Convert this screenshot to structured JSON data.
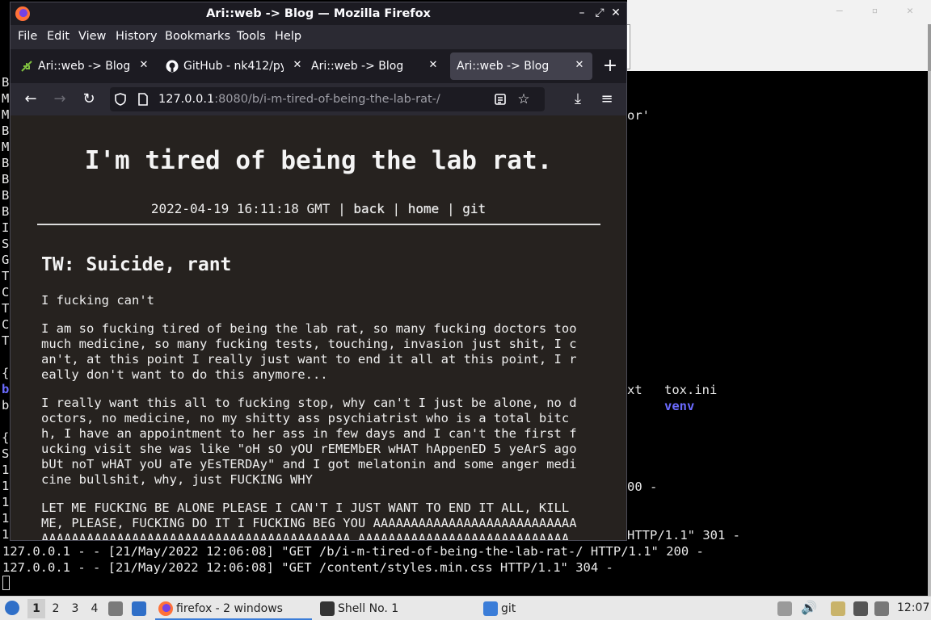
{
  "terminal": {
    "left_column": [
      "B",
      "M",
      "M",
      "B",
      "M",
      "B",
      "B",
      "B",
      "B",
      "I",
      "S",
      "G",
      "T",
      "C",
      "T",
      "C",
      "T",
      "",
      "{",
      "b",
      "b",
      "",
      "{",
      "S",
      "1",
      "1",
      "1",
      "1",
      "1"
    ],
    "fragment_quote": "or'",
    "ls_row": {
      "col1": "xt",
      "col2": "tox.ini"
    },
    "ls_dir": "venv",
    "status_200": "00 -",
    "log_line_1_tail": "HTTP/1.1\" 301 -",
    "log_line_2": "127.0.0.1 - - [21/May/2022 12:06:08] \"GET /b/i-m-tired-of-being-the-lab-rat-/ HTTP/1.1\" 200 -",
    "log_line_3": "127.0.0.1 - - [21/May/2022 12:06:08] \"GET /content/styles.min.css HTTP/1.1\" 304 -"
  },
  "firefox": {
    "window_title": "Ari::web -> Blog — Mozilla Firefox",
    "menu": [
      "File",
      "Edit",
      "View",
      "History",
      "Bookmarks",
      "Tools",
      "Help"
    ],
    "tabs": [
      {
        "label": "Ari::web -> Blog",
        "icon": "leaf-icon"
      },
      {
        "label": "GitHub - nk412/py",
        "icon": "github-icon"
      },
      {
        "label": "Ari::web -> Blog",
        "icon": ""
      },
      {
        "label": "Ari::web -> Blog",
        "icon": "",
        "active": true
      }
    ],
    "url_host": "127.0.0.1",
    "url_rest": ":8080/b/i-m-tired-of-being-the-lab-rat-/"
  },
  "page": {
    "title": "I'm tired of being the lab rat.",
    "date": "2022-04-19 16:11:18 GMT",
    "sep": " | ",
    "nav": [
      "back",
      "home",
      "git"
    ],
    "heading": "TW: Suicide, rant",
    "p1": "I fucking can't",
    "p2": "I am so fucking tired of being the lab rat, so many fucking doctors too\nmuch medicine, so many fucking tests, touching, invasion just shit, I c\nan't, at this point I really just want to end it all at this point, I r\neally don't want to do this anymore...",
    "p3": "I really want this all to fucking stop, why can't I just be alone, no d\noctors, no medicine, no my shitty ass psychiatrist who is a total bitc\nh, I have an appointment to her ass in few days and I can't the first f\nucking visit she was like \"oH sO yOU rEMEMbER wHAT hAppenED 5 yeArS ago\nbUt noT wHAT yoU aTe yEsTERDAy\" and I got melatonin and some anger medi\ncine bullshit, why, just FUCKING WHY",
    "p4": "LET ME FUCKING BE ALONE PLEASE I CAN'T I JUST WANT TO END IT ALL, KILL\nME, PLEASE, FUCKING DO IT I FUCKING BEG YOU AAAAAAAAAAAAAAAAAAAAAAAAAAA\nAAAAAAAAAAAAAAAAAAAAAAAAAAAAAAAAAAAAAAAAA AAAAAAAAAAAAAAAAAAAAAAAAAAAA"
  },
  "taskbar": {
    "workspaces": [
      "1",
      "2",
      "3",
      "4"
    ],
    "windows": [
      {
        "label": "firefox - 2 windows",
        "icon": "firefox-icon"
      },
      {
        "label": "Shell No. 1",
        "icon": "terminal-icon"
      },
      {
        "label": "git",
        "icon": "folder-icon"
      }
    ],
    "clock": "12:07"
  }
}
